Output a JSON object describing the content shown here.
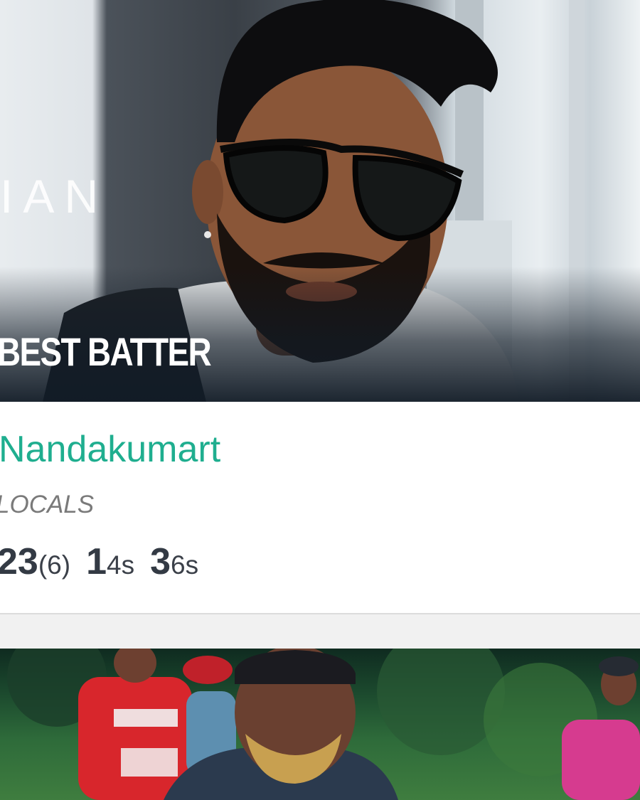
{
  "card1": {
    "sponsor_text": "IAN",
    "award_title": "BEST BATTER",
    "player_name": "Nandakumart",
    "team_name": "LOCALS",
    "stats": {
      "runs": "23",
      "balls": "(6)",
      "fours_count": "1",
      "fours_label": "4s",
      "sixes_count": "3",
      "sixes_label": "6s"
    }
  },
  "colors": {
    "accent": "#1fae8f",
    "stat_text": "#333a44",
    "team_text": "#7a7a7a",
    "overlay": "#111b26"
  }
}
